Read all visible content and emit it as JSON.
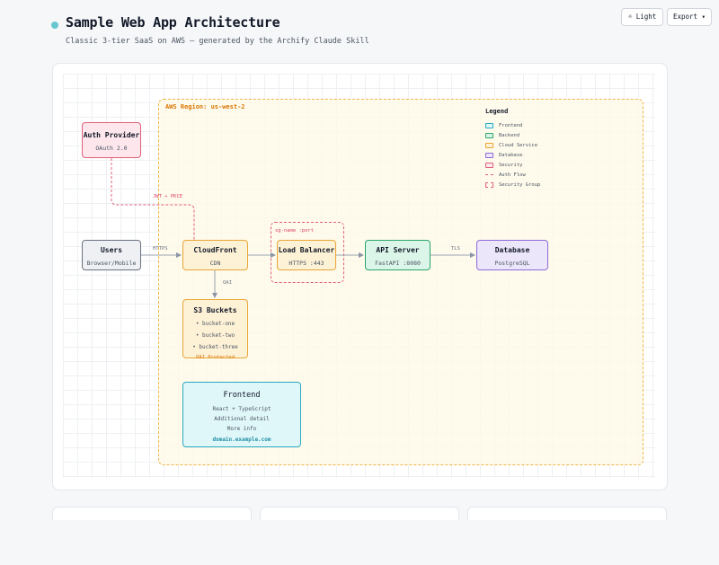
{
  "header": {
    "title": "Sample Web App Architecture",
    "subtitle": "Classic 3-tier SaaS on AWS — generated by the Archify Claude Skill",
    "btn_light": "☼ Light",
    "btn_export": "Export ▾"
  },
  "region": {
    "label": "AWS Region: us-west-2"
  },
  "nodes": {
    "auth": {
      "title": "Auth Provider",
      "sub": "OAuth 2.0"
    },
    "users": {
      "title": "Users",
      "sub": "Browser/Mobile"
    },
    "cloudfront": {
      "title": "CloudFront",
      "sub": "CDN"
    },
    "lb": {
      "title": "Load Balancer",
      "sub": "HTTPS :443"
    },
    "api": {
      "title": "API Server",
      "sub": "FastAPI :8080"
    },
    "db": {
      "title": "Database",
      "sub": "PostgreSQL"
    },
    "s3": {
      "title": "S3 Buckets",
      "lines": [
        "• bucket-one",
        "• bucket-two",
        "• bucket-three"
      ],
      "note": "OAI Protected"
    },
    "frontend": {
      "title": "Frontend",
      "lines": [
        "React + TypeScript",
        "Additional detail",
        "More info"
      ],
      "domain": "domain.example.com"
    }
  },
  "security_group": {
    "label": "sg-name :port"
  },
  "edges": {
    "https": "HTTPS",
    "oai": "OAI",
    "tls": "TLS",
    "jwt": "JWT + PKCE"
  },
  "legend": {
    "title": "Legend",
    "items": [
      "Frontend",
      "Backend",
      "Cloud Service",
      "Database",
      "Security",
      "Auth Flow",
      "Security Group"
    ]
  },
  "colors": {
    "frontend": "#29a8c0",
    "backend": "#2aa66b",
    "cloud_service": "#e9a636",
    "database": "#8b6ad8",
    "security": "#e0607a",
    "region": "#f0b54a"
  }
}
